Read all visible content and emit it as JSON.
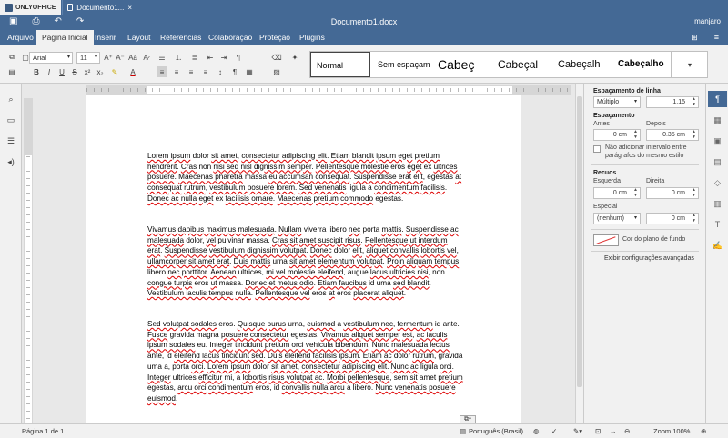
{
  "titlebar": {
    "brand": "ONLYOFFICE",
    "tab": "Documento1...",
    "tab_close": "×"
  },
  "header": {
    "title": "Documento1.docx",
    "user": "manjaro"
  },
  "menu": {
    "tabs": [
      "Arquivo",
      "Página Inicial",
      "Inserir",
      "Layout",
      "Referências",
      "Colaboração",
      "Proteção",
      "Plugins"
    ],
    "active": "Página Inicial"
  },
  "toolbar": {
    "font_family": "Arial",
    "font_size": "11",
    "styles": [
      "Normal",
      "Sem espaçam",
      "Cabeç",
      "Cabeçal",
      "Cabeçalh",
      "Cabeçalho"
    ],
    "selected_style": "Normal"
  },
  "document": {
    "paragraphs": [
      [
        [
          "Lorem ipsum",
          1
        ],
        " dolor ",
        [
          "sit amet",
          1
        ],
        ", ",
        [
          "consectetur adipiscing elit",
          1
        ],
        ". ",
        [
          "Etiam blandit",
          1
        ],
        "  ",
        [
          "ipsum eget",
          1
        ],
        " ",
        [
          "pretium hendrerit",
          1
        ],
        ". ",
        [
          "Cras",
          1
        ],
        " non ",
        [
          "nisi sed nisl dignissim semper",
          1
        ],
        ".  ",
        [
          "Pellentesque molestie",
          1
        ],
        " eros ",
        [
          "eget",
          1
        ],
        " ex ",
        [
          "ultrices posuere",
          1
        ],
        ". ",
        [
          "Maecenas pharetra",
          1
        ],
        "  massa ",
        [
          "eu accumsan consequat",
          1
        ],
        ". ",
        [
          "Suspendisse erat elit",
          1
        ],
        ", egestas ",
        [
          "at consequat",
          1
        ],
        "  ",
        [
          "rutrum",
          1
        ],
        ", ",
        [
          "vestibulum posuere lorem",
          1
        ],
        ". ",
        [
          "Sed venenatis",
          1
        ],
        " ligula a ",
        [
          "condimentum",
          1
        ],
        "  ",
        [
          "facilisis",
          1
        ],
        ". ",
        [
          "Donec ac nulla",
          1
        ],
        " ",
        [
          "eget",
          1
        ],
        " ex ",
        [
          "facilisis ornare",
          1
        ],
        ". ",
        [
          "Maecenas pretium",
          1
        ],
        "  ",
        [
          "commodo",
          1
        ],
        " egestas."
      ],
      [
        [
          "Vivamus dapibus maximus malesuada",
          1
        ],
        ". ",
        [
          "Nullam",
          1
        ],
        " viverra libero ",
        [
          "nec",
          1
        ],
        " porta  ",
        [
          "mattis",
          1
        ],
        ". ",
        [
          "Suspendisse ac malesuada",
          1
        ],
        " dolor, ",
        [
          "vel",
          1
        ],
        " pulvinar massa. ",
        [
          "Cras sit",
          1
        ],
        "  ",
        [
          "amet suscipit risus",
          1
        ],
        ". ",
        [
          "Pellentesque ut interdum erat",
          1
        ],
        ". ",
        [
          "Suspendisse",
          1
        ],
        "  ",
        [
          "vestibulum dignissim volutpat",
          1
        ],
        ". ",
        [
          "Donec",
          1
        ],
        " dolor ",
        [
          "elit",
          1
        ],
        ", ",
        [
          "aliquet convallis",
          1
        ],
        "  ",
        [
          "lobortis vel",
          1
        ],
        ", ",
        [
          "ullamcorper sit amet erat",
          1
        ],
        ". ",
        [
          "Duis mattis",
          1
        ],
        " urna ",
        [
          "sit amet",
          1
        ],
        "  ",
        [
          "elementum volutpat",
          1
        ],
        ". ",
        [
          "Proin aliquam tempus",
          1
        ],
        " libero ",
        [
          "nec porttitor",
          1
        ],
        ". ",
        [
          "Aenean",
          1
        ],
        "  ultrices, ",
        [
          "mi vel molestie eleifend",
          1
        ],
        ",  augue ",
        [
          "lacus ultricies nisi",
          1
        ],
        ", non  ",
        [
          "congue turpis",
          1
        ],
        " eros ",
        [
          "ut",
          1
        ],
        " massa. ",
        [
          "Donec et metus odio",
          1
        ],
        ". ",
        [
          "Etiam faucibus",
          1
        ],
        " id uma  ",
        [
          "sed blandit",
          1
        ],
        ". ",
        [
          "Vestibulum iaculis tempus",
          1
        ],
        " ",
        [
          "nulla",
          1
        ],
        ". ",
        [
          "Pellentesque vel",
          1
        ],
        " eros ",
        [
          "at",
          1
        ],
        "  eros ",
        [
          "placerat aliquet",
          1
        ],
        "."
      ],
      [
        [
          "Sed volutpat sodales",
          1
        ],
        " eros. ",
        [
          "Quisque purus",
          1
        ],
        " urna, ",
        [
          "euismod",
          1
        ],
        " a ",
        [
          "vestibulum nec",
          1
        ],
        ",  ",
        [
          "fermentum",
          1
        ],
        " id ante. ",
        [
          "Fusce",
          1
        ],
        " gravida magna ",
        [
          "posuere consectetur",
          1
        ],
        " egestas.  ",
        [
          "Vivamus aliquet semper",
          1
        ],
        " ",
        [
          "est",
          1
        ],
        ", ",
        [
          "ac iaculis ipsum sodales",
          1
        ],
        " eu. ",
        [
          "Integer",
          1
        ],
        "  ",
        [
          "tincidunt pretium orci vehicula bibendum",
          1
        ],
        ". ",
        [
          "Nunc malesuada lectus",
          1
        ],
        " ante, id  ",
        [
          "eleifend lacus tincidunt sed",
          1
        ],
        ". ",
        [
          "Duis eleifend facilisis",
          1
        ],
        " ",
        [
          "ipsum",
          1
        ],
        ". ",
        [
          "Etiam ac",
          1
        ],
        "  dolor ",
        [
          "rutrum",
          1
        ],
        ", gravida uma a, porta ",
        [
          "orci",
          1
        ],
        ". ",
        [
          "Lorem ipsum",
          1
        ],
        " dolor ",
        [
          "sit amet",
          1
        ],
        ", ",
        [
          "consectetur adipiscing elit",
          1
        ],
        ". ",
        [
          "Nunc ac",
          1
        ],
        " ligula ",
        [
          "orci",
          1
        ],
        ". ",
        [
          "Integer",
          1
        ],
        " ultrices  ",
        [
          "efficitur",
          1
        ],
        " mi, a ",
        [
          "lobortis",
          1
        ],
        " ",
        [
          "risus volutpat ac",
          1
        ],
        ". ",
        [
          "Morbi pellentesque",
          1
        ],
        ", sem ",
        [
          "sit",
          1
        ],
        "  amet ",
        [
          "pretium",
          1
        ],
        " egestas, ",
        [
          "arcu orci",
          1
        ],
        " ",
        [
          "condimentum",
          1
        ],
        " eros, id ",
        [
          "convallis nulla",
          1
        ],
        "  ",
        [
          "arcu",
          1
        ],
        " a libero. ",
        [
          "Nunc venenatis posuere euismod",
          1
        ],
        "."
      ]
    ]
  },
  "right_panel": {
    "line_spacing_title": "Espaçamento de linha",
    "line_spacing_mode": "Múltiplo",
    "line_spacing_value": "1.15",
    "spacing_title": "Espaçamento",
    "before_label": "Antes",
    "before_value": "0 cm",
    "after_label": "Depois",
    "after_value": "0.35 cm",
    "no_interval_label_1": "Não adicionar intervalo entre",
    "no_interval_label_2": "parágrafos do mesmo estilo",
    "indents_title": "Recuos",
    "left_label": "Esquerda",
    "left_value": "0 cm",
    "right_label": "Direita",
    "right_value": "0 cm",
    "special_label": "Especial",
    "special_value": "(nenhum)",
    "special_amount": "0 cm",
    "bg_color_label": "Cor do plano de fundo",
    "advanced_link": "Exibir configurações avançadas"
  },
  "statusbar": {
    "page": "Página 1 de 1",
    "language": "Português (Brasil)",
    "zoom": "Zoom 100%"
  }
}
